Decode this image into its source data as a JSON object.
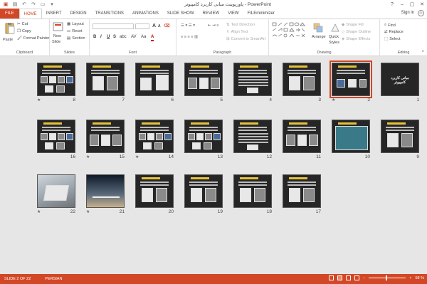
{
  "app": {
    "title": "پاورپوینت مبانی کاربرد کامپیوتر - PowerPoint",
    "accent": "#d24726"
  },
  "qat": {
    "icons": [
      "save-icon",
      "undo-icon",
      "redo-icon",
      "start-from-beginning-icon",
      "customize-icon"
    ]
  },
  "window": {
    "help": "?",
    "minimize": "–",
    "restore": "▢",
    "close": "✕"
  },
  "tabs": [
    {
      "label": "FILE"
    },
    {
      "label": "HOME"
    },
    {
      "label": "INSERT"
    },
    {
      "label": "DESIGN"
    },
    {
      "label": "TRANSITIONS"
    },
    {
      "label": "ANIMATIONS"
    },
    {
      "label": "SLIDE SHOW"
    },
    {
      "label": "REVIEW"
    },
    {
      "label": "VIEW"
    },
    {
      "label": "FILEminimizer"
    }
  ],
  "signin": "Sign in",
  "ribbon": {
    "clipboard": {
      "label": "Clipboard",
      "paste": "Paste",
      "cut": "Cut",
      "copy": "Copy",
      "format_painter": "Format Painter"
    },
    "slides": {
      "label": "Slides",
      "new_slide": "New",
      "new_slide_2": "Slide",
      "layout": "Layout",
      "reset": "Reset",
      "section": "Section"
    },
    "font": {
      "label": "Font",
      "bold": "B",
      "italic": "I",
      "underline": "U",
      "strike": "S",
      "shadow": "abc",
      "spacing": "AV",
      "case": "Aa",
      "color": "A",
      "grow": "A",
      "shrink": "A"
    },
    "paragraph": {
      "label": "Paragraph",
      "text_direction": "Text Direction",
      "align_text": "Align Text",
      "convert_smartart": "Convert to SmartArt"
    },
    "drawing": {
      "label": "Drawing",
      "arrange": "Arrange",
      "quick_styles": "Quick",
      "quick_styles_2": "Styles",
      "shape_fill": "Shape Fill",
      "shape_outline": "Shape Outline",
      "shape_effects": "Shape Effects"
    },
    "editing": {
      "label": "Editing",
      "find": "Find",
      "replace": "Replace",
      "select": "Select"
    }
  },
  "slides": [
    {
      "num": "8",
      "star": "★"
    },
    {
      "num": "7",
      "star": ""
    },
    {
      "num": "6",
      "star": ""
    },
    {
      "num": "5",
      "star": ""
    },
    {
      "num": "4",
      "star": ""
    },
    {
      "num": "3",
      "star": ""
    },
    {
      "num": "2",
      "star": "★",
      "selected": true
    },
    {
      "num": "1",
      "star": "",
      "title": "مبانی کاربرد کامپیوتر"
    },
    {
      "num": "16",
      "star": ""
    },
    {
      "num": "15",
      "star": "★"
    },
    {
      "num": "14",
      "star": "★"
    },
    {
      "num": "13",
      "star": ""
    },
    {
      "num": "12",
      "star": ""
    },
    {
      "num": "11",
      "star": ""
    },
    {
      "num": "10",
      "star": ""
    },
    {
      "num": "9",
      "star": ""
    },
    {
      "num": "22",
      "star": "★"
    },
    {
      "num": "21",
      "star": "★"
    },
    {
      "num": "20",
      "star": ""
    },
    {
      "num": "19",
      "star": ""
    },
    {
      "num": "18",
      "star": ""
    },
    {
      "num": "17",
      "star": ""
    }
  ],
  "status": {
    "slide": "SLIDE 2 OF 22",
    "language": "PERSIAN",
    "zoom": "58 %"
  }
}
